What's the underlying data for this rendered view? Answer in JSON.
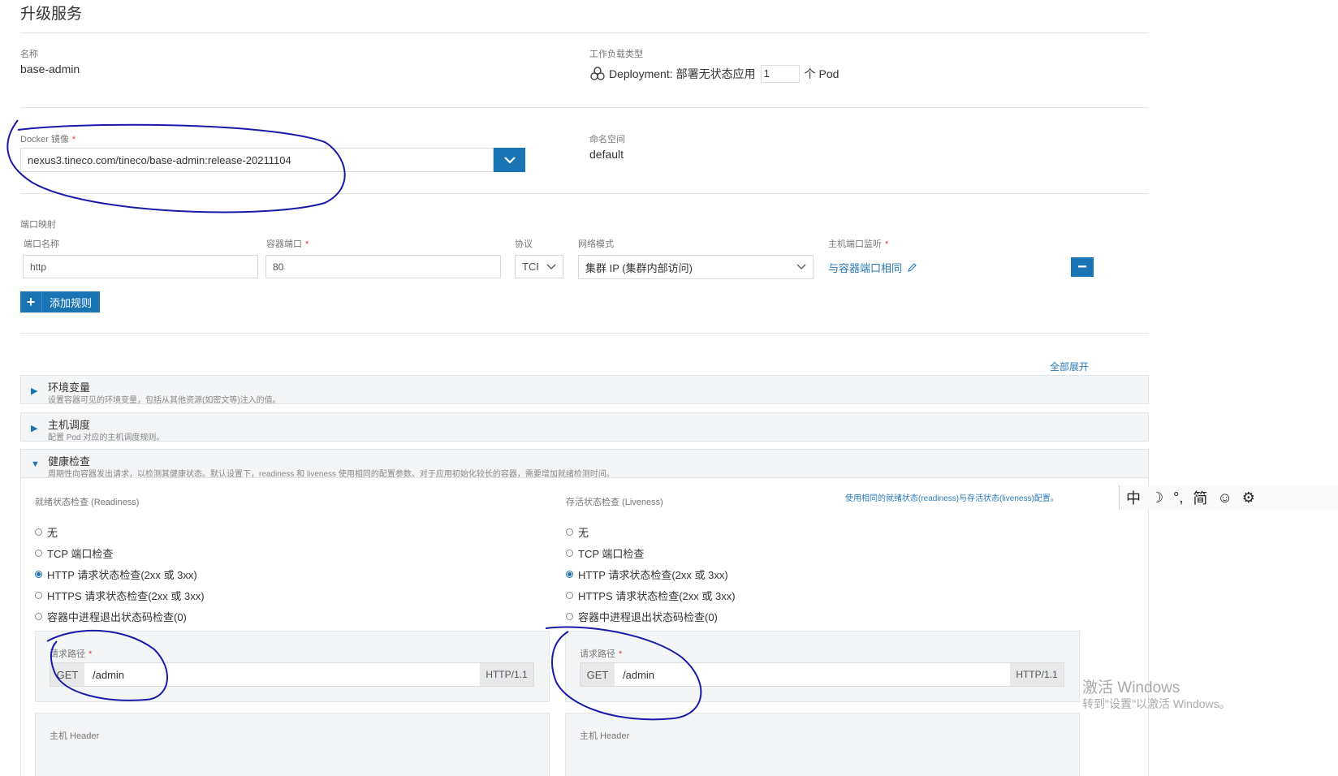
{
  "page_title": "升级服务",
  "name_section": {
    "label": "名称",
    "value": "base-admin"
  },
  "workload": {
    "label": "工作负载类型",
    "type_text": "Deployment:",
    "type_desc": "部署无状态应用",
    "replicas": "1",
    "unit": "个 Pod"
  },
  "docker": {
    "label": "Docker 镜像",
    "required_mark": "*",
    "image": "nexus3.tineco.com/tineco/base-admin:release-20211104"
  },
  "namespace": {
    "label": "命名空间",
    "value": "default"
  },
  "ports": {
    "section_label": "端口映射",
    "col_name": "端口名称",
    "col_container_port": "容器端口",
    "col_protocol": "协议",
    "col_network": "网络模式",
    "col_host": "主机端口监听",
    "required_mark": "*",
    "row": {
      "name": "http",
      "container_port": "80",
      "protocol": "TCF",
      "network": "集群 IP (集群内部访问)",
      "host": "与容器端口相同"
    },
    "add_rule": "添加规则",
    "remove_symbol": "−",
    "add_symbol": "+"
  },
  "expand_all": "全部展开",
  "env": {
    "title": "环境变量",
    "desc": "设置容器可见的环境变量，包括从其他资源(如密文等)注入的值。"
  },
  "scheduling": {
    "title": "主机调度",
    "desc": "配置 Pod 对应的主机调度规则。"
  },
  "health": {
    "title": "健康检查",
    "desc": "周期性向容器发出请求，以检测其健康状态。默认设置下，readiness 和 liveness 使用相同的配置参数。对于应用初始化较长的容器，需要增加就绪检测时间。",
    "same_config_link": "使用相同的就绪状态(readiness)与存活状态(liveness)配置。",
    "readiness": {
      "label": "就绪状态检查 (Readiness)",
      "options": [
        "无",
        "TCP 端口检查",
        "HTTP 请求状态检查(2xx 或 3xx)",
        "HTTPS 请求状态检查(2xx 或 3xx)",
        "容器中进程退出状态码检查(0)"
      ],
      "path_label": "请求路径",
      "method": "GET",
      "path": "/admin",
      "version": "HTTP/1.1",
      "header_label": "主机 Header"
    },
    "liveness": {
      "label": "存活状态检查 (Liveness)",
      "options": [
        "无",
        "TCP 端口检查",
        "HTTP 请求状态检查(2xx 或 3xx)",
        "HTTPS 请求状态检查(2xx 或 3xx)",
        "容器中进程退出状态码检查(0)"
      ],
      "path_label": "请求路径",
      "method": "GET",
      "path": "/admin",
      "version": "HTTP/1.1",
      "header_label": "主机 Header"
    },
    "selected_option_index": 2
  },
  "ime": {
    "mode": "中",
    "moon": "☽",
    "punct": "°,",
    "simp": "简",
    "smile": "☺",
    "gear": "⚙"
  },
  "watermark": {
    "line1": "激活 Windows",
    "line2": "转到\"设置\"以激活 Windows。"
  },
  "colors": {
    "accent": "#1a74b4",
    "annotation": "#1a1aa8"
  }
}
